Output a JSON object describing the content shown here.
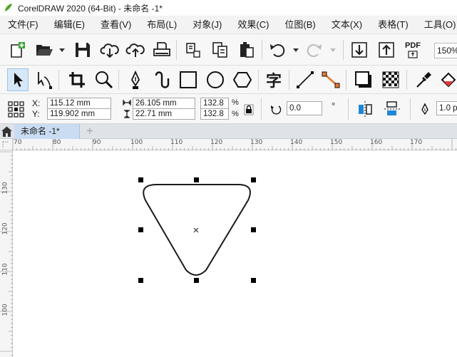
{
  "window": {
    "title": "CorelDRAW 2020 (64-Bit) - 未命名 -1*"
  },
  "menu": [
    {
      "label": "文件(F)"
    },
    {
      "label": "编辑(E)"
    },
    {
      "label": "查看(V)"
    },
    {
      "label": "布局(L)"
    },
    {
      "label": "对象(J)"
    },
    {
      "label": "效果(C)"
    },
    {
      "label": "位图(B)"
    },
    {
      "label": "文本(X)"
    },
    {
      "label": "表格(T)"
    },
    {
      "label": "工具(O)"
    }
  ],
  "toolbar": {
    "zoom_value": "150%",
    "pdf_label": "PDF"
  },
  "toolbox": {
    "text_tool_glyph": "字"
  },
  "propbar": {
    "x_label": "X:",
    "y_label": "Y:",
    "x_value": "115.12 mm",
    "y_value": "119.902 mm",
    "width_value": "26.105 mm",
    "height_value": "22.71 mm",
    "scale_x": "132.8",
    "scale_y": "132.8",
    "percent_1": "%",
    "percent_2": "%",
    "rotation_value": "0.0",
    "degree_symbol": "°",
    "outline_value": "1.0 p"
  },
  "tabs": {
    "document_tab": "未命名 -1*",
    "add_tab": "+"
  },
  "ruler": {
    "top_ticks": [
      "70",
      "80",
      "90",
      "100",
      "110",
      "120",
      "130",
      "140",
      "150",
      "160",
      "170"
    ],
    "left_ticks": [
      "130",
      "120",
      "110",
      "100"
    ]
  },
  "colors": {
    "accent_blue": "#1e88d6",
    "orange": "#e8772e",
    "logo_green": "#6fbf3c"
  }
}
